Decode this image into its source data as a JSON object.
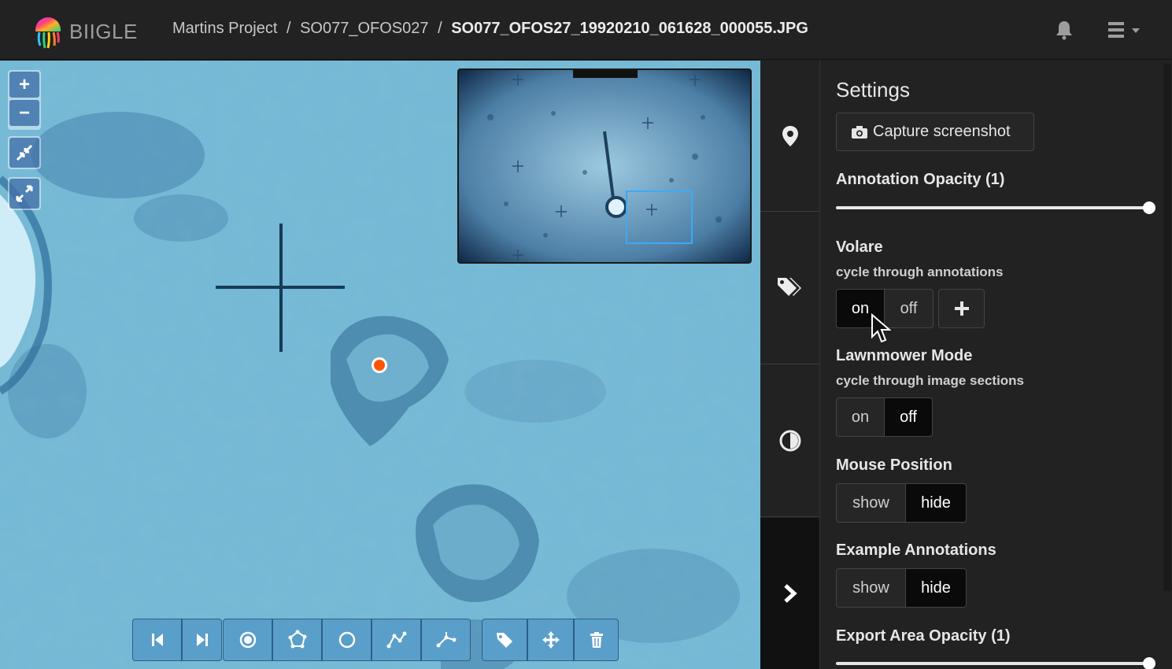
{
  "navbar": {
    "brand": "BIIGLE",
    "breadcrumb": {
      "project": "Martins Project",
      "volume": "SO077_OFOS027",
      "image": "SO077_OFOS27_19920210_061628_000055.JPG",
      "separator": "/"
    },
    "icons": [
      "bell-icon",
      "menu-icon"
    ]
  },
  "viewer": {
    "zoom_in": "+",
    "zoom_out": "−",
    "icons": [
      "zoom-to-native-icon",
      "fullscreen-icon"
    ]
  },
  "toolbar": {
    "buttons": [
      "previous-image",
      "next-image",
      "point-tool",
      "polygon-tool",
      "circle-tool",
      "linestring-tool",
      "measure-tool",
      "attach-label",
      "move-annotation",
      "delete-annotation"
    ]
  },
  "sidebar": {
    "tabs": [
      "annotations-tab",
      "labels-tab",
      "color-adjustment-tab",
      "collapse-tab"
    ]
  },
  "settings": {
    "title": "Settings",
    "capture_label": "Capture screenshot",
    "annotation_opacity_label": "Annotation Opacity (1)",
    "annotation_opacity": 1,
    "volare": {
      "label": "Volare",
      "sublabel": "cycle through annotations",
      "on": "on",
      "off": "off",
      "active": "on"
    },
    "lawnmower": {
      "label": "Lawnmower Mode",
      "sublabel": "cycle through image sections",
      "on": "on",
      "off": "off",
      "active": "off"
    },
    "mouse_position": {
      "label": "Mouse Position",
      "show": "show",
      "hide": "hide",
      "active": "hide"
    },
    "example_annotations": {
      "label": "Example Annotations",
      "show": "show",
      "hide": "hide",
      "active": "hide"
    },
    "export_area_opacity_label": "Export Area Opacity (1)",
    "export_area_opacity": 1
  },
  "colors": {
    "navbar_bg": "#222222",
    "accent_annotation": "#ff5500",
    "minimap_viewport": "#3fa9f5",
    "water": "#6fb7d4"
  }
}
